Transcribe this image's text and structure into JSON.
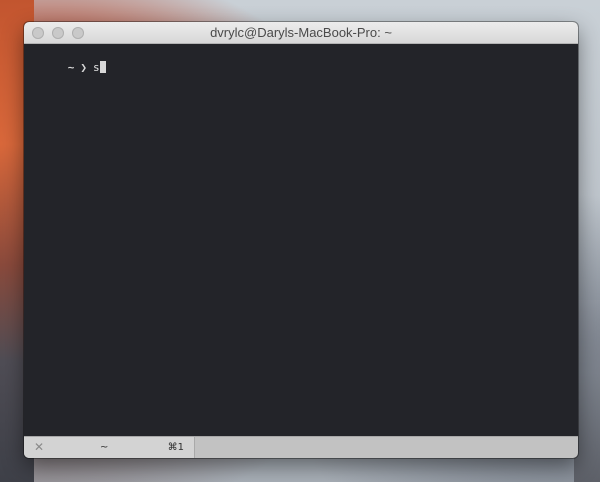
{
  "window": {
    "title": "dvrylc@Daryls-MacBook-Pro: ~"
  },
  "terminal": {
    "prompt_dir": "~",
    "prompt_symbol": "❯",
    "command_input": "s"
  },
  "tabs": [
    {
      "close_glyph": "✕",
      "title": "~",
      "shortcut": "⌘1"
    }
  ],
  "colors": {
    "terminal_background": "#232429",
    "terminal_text": "#e6e6e6",
    "titlebar": "#e0e0e0",
    "tabbar": "#c2c2c2"
  }
}
